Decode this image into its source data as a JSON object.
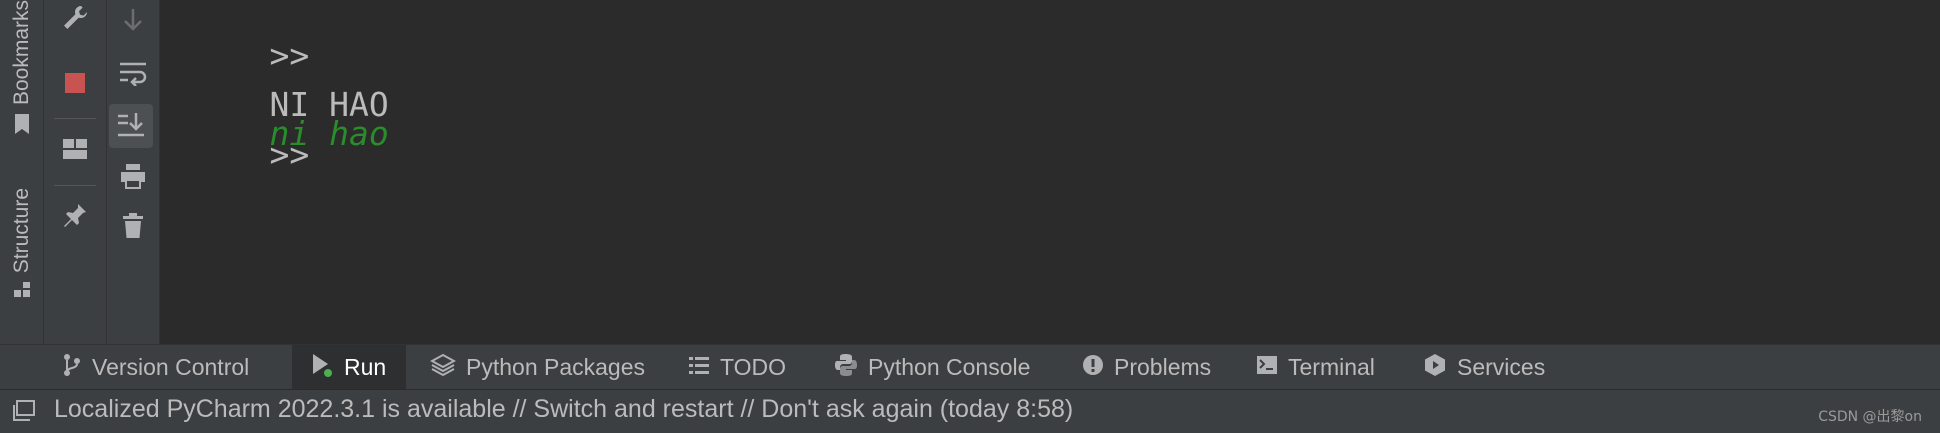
{
  "side_tabs": {
    "bookmarks_label": "Bookmarks",
    "structure_label": "Structure"
  },
  "console": {
    "lines": [
      {
        "prompt": ">>",
        "input": "ni hao"
      },
      {
        "output": "NI HAO"
      },
      {
        "prompt": ">>"
      }
    ]
  },
  "tool_windows": {
    "version_control": "Version Control",
    "run": "Run",
    "python_packages": "Python Packages",
    "todo": "TODO",
    "python_console": "Python Console",
    "problems": "Problems",
    "terminal": "Terminal",
    "services": "Services"
  },
  "status": {
    "message": "Localized PyCharm 2022.3.1 is available // Switch and restart // Don't ask again (today 8:58)",
    "watermark": "CSDN @出黎on"
  },
  "colors": {
    "background": "#2b2b2b",
    "panel": "#3c3f41",
    "input_green": "#2a8c2a",
    "stop_red": "#c75450",
    "run_dot": "#4caf50"
  }
}
